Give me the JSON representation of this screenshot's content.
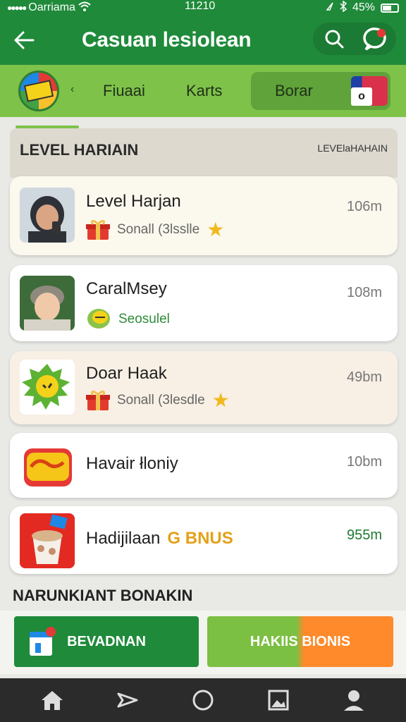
{
  "status_bar": {
    "carrier": "Oarriama",
    "time": "11210",
    "battery": "45%"
  },
  "header": {
    "title": "Casuan lesiolean"
  },
  "tabs": [
    {
      "label": "Fiuaai"
    },
    {
      "label": "Karts"
    },
    {
      "label": "Borar"
    }
  ],
  "section": {
    "title": "LEVEL HARIAIN",
    "link": "LEVElaHAHAIN"
  },
  "items": [
    {
      "name": "Level Harjan",
      "subtitle": "Sonall (3lsslle",
      "meta": "106m"
    },
    {
      "name": "CaralMsey",
      "subtitle": "Seosulel",
      "meta": "108m"
    },
    {
      "name": "Doar Haak",
      "subtitle": "Sonall (3lesdle",
      "meta": "49bm"
    },
    {
      "name": "Havair łloniy",
      "subtitle": "",
      "meta": "10bm"
    },
    {
      "name": "Hadijilaan",
      "bonus": "G BNUS",
      "meta": "955m"
    }
  ],
  "footer": {
    "title": "NARUNKIANT BONAKIN",
    "button_left": "BEVADNAN",
    "button_right": "HAKIIS BIONIS"
  },
  "colors": {
    "primary_green": "#1f8a3a",
    "tab_green": "#7ec24a",
    "bonus_orange": "#e3a11a",
    "accent_orange": "#ff8a2b"
  },
  "icons": {
    "back": "arrow-left-icon",
    "search": "search-icon",
    "chat": "chat-bubble-icon",
    "gift": "gift-icon",
    "star": "star-icon",
    "home": "home-icon",
    "send": "send-icon",
    "circle": "circle-icon",
    "gallery": "image-icon",
    "profile": "person-icon"
  }
}
